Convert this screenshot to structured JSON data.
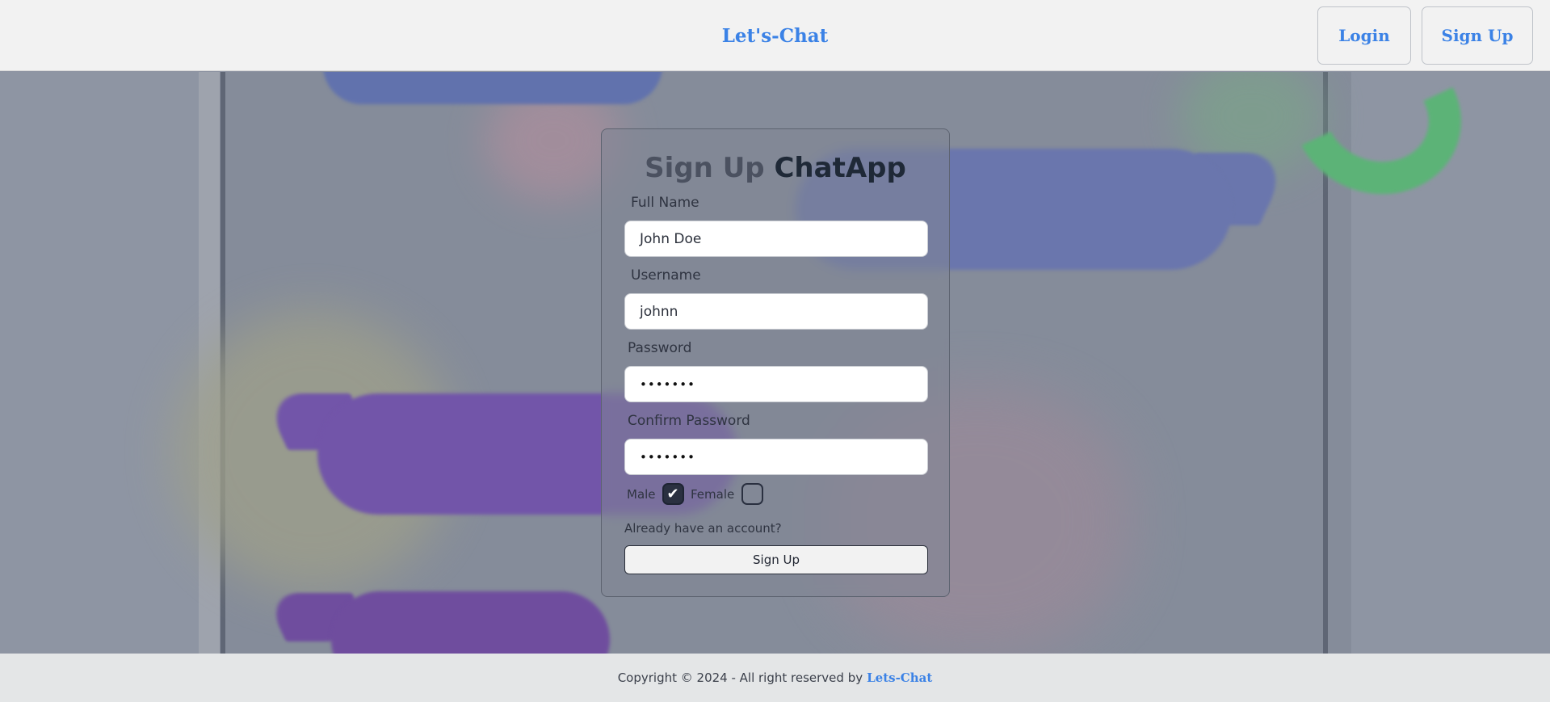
{
  "navbar": {
    "brand": "Let's-Chat",
    "login_label": "Login",
    "signup_label": "Sign Up"
  },
  "form": {
    "title_part1": "Sign Up",
    "title_part2": "ChatApp",
    "full_name_label": "Full Name",
    "full_name_value": "John Doe",
    "username_label": "Username",
    "username_value": "johnn",
    "password_label": "Password",
    "password_value": "•••••••",
    "confirm_password_label": "Confirm Password",
    "confirm_password_value": "•••••••",
    "gender_male_label": "Male",
    "gender_female_label": "Female",
    "male_checked": true,
    "female_checked": false,
    "already_account": "Already have an account?",
    "submit_label": "Sign Up"
  },
  "footer": {
    "copyright": "Copyright © 2024 - All right reserved by",
    "brand_link": "Lets-Chat"
  },
  "colors": {
    "accent": "#3b82e6",
    "checkbox_fill": "#2a3040"
  }
}
